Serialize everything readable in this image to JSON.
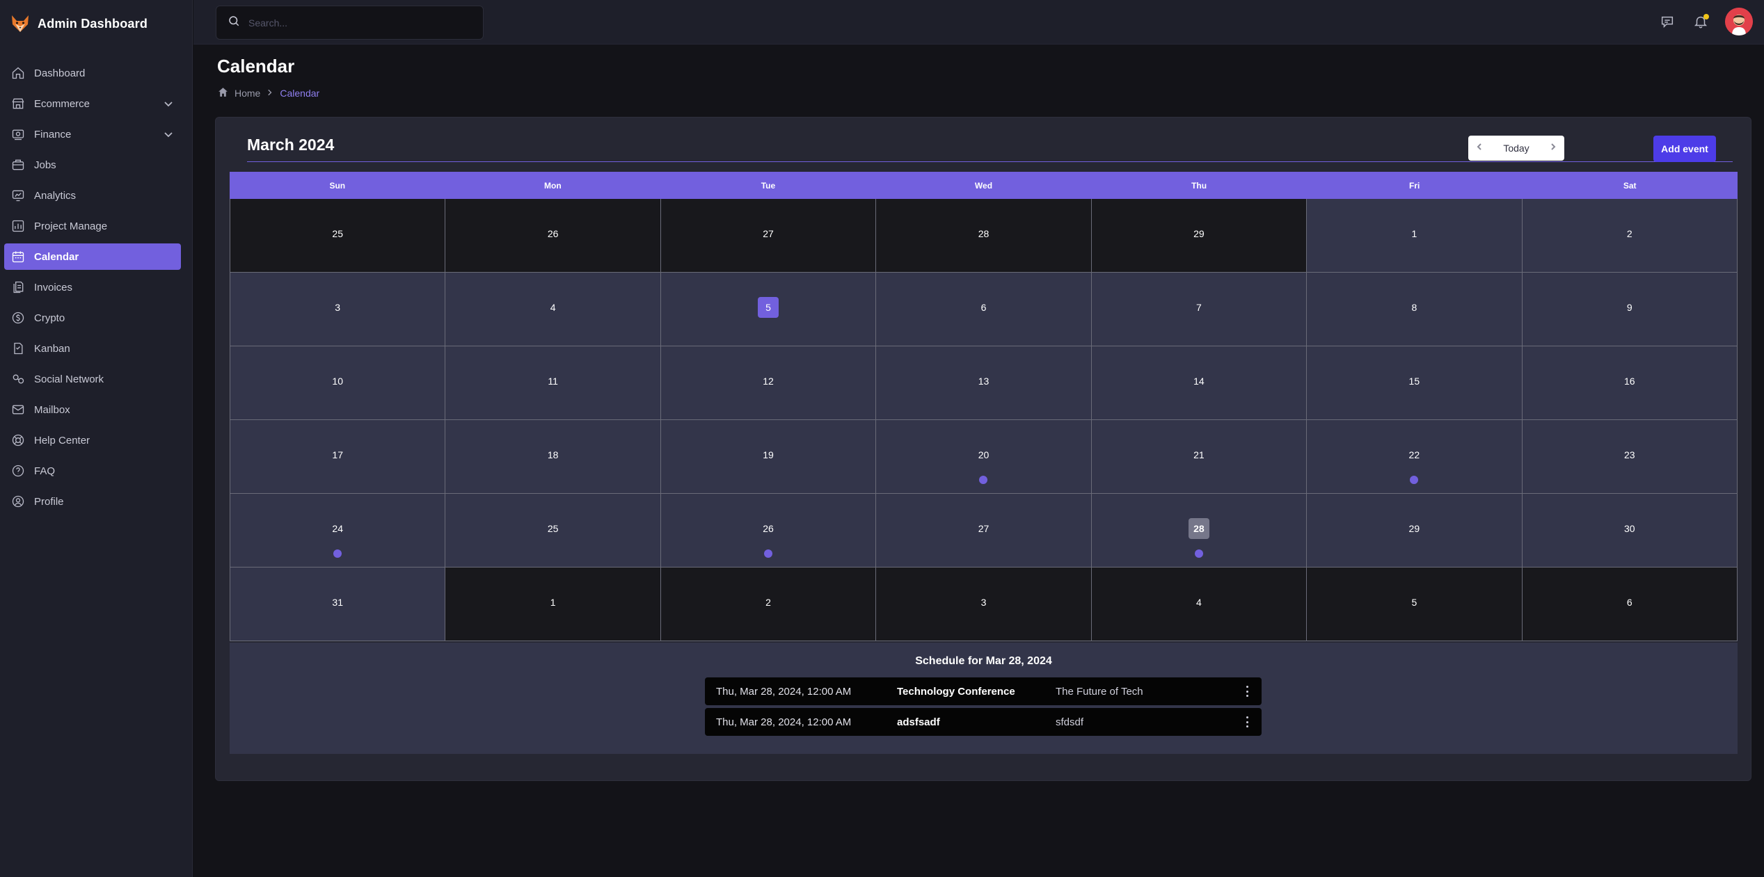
{
  "brand": {
    "title": "Admin Dashboard"
  },
  "sidebar": {
    "items": [
      {
        "label": "Dashboard",
        "icon": "home-icon",
        "active": false,
        "expandable": false
      },
      {
        "label": "Ecommerce",
        "icon": "store-icon",
        "active": false,
        "expandable": true
      },
      {
        "label": "Finance",
        "icon": "finance-icon",
        "active": false,
        "expandable": true
      },
      {
        "label": "Jobs",
        "icon": "briefcase-icon",
        "active": false,
        "expandable": false
      },
      {
        "label": "Analytics",
        "icon": "analytics-icon",
        "active": false,
        "expandable": false
      },
      {
        "label": "Project Manage",
        "icon": "project-icon",
        "active": false,
        "expandable": false
      },
      {
        "label": "Calendar",
        "icon": "calendar-icon",
        "active": true,
        "expandable": false
      },
      {
        "label": "Invoices",
        "icon": "invoice-icon",
        "active": false,
        "expandable": false
      },
      {
        "label": "Crypto",
        "icon": "crypto-icon",
        "active": false,
        "expandable": false
      },
      {
        "label": "Kanban",
        "icon": "kanban-icon",
        "active": false,
        "expandable": false
      },
      {
        "label": "Social Network",
        "icon": "social-icon",
        "active": false,
        "expandable": false
      },
      {
        "label": "Mailbox",
        "icon": "mail-icon",
        "active": false,
        "expandable": false
      },
      {
        "label": "Help Center",
        "icon": "help-center-icon",
        "active": false,
        "expandable": false
      },
      {
        "label": "FAQ",
        "icon": "faq-icon",
        "active": false,
        "expandable": false
      },
      {
        "label": "Profile",
        "icon": "profile-icon",
        "active": false,
        "expandable": false
      }
    ]
  },
  "search": {
    "placeholder": "Search...",
    "value": ""
  },
  "page": {
    "title": "Calendar",
    "breadcrumb": {
      "home": "Home",
      "current": "Calendar"
    }
  },
  "calendar": {
    "month_title": "March 2024",
    "today_label": "Today",
    "add_event_label": "Add event",
    "weekdays": [
      "Sun",
      "Mon",
      "Tue",
      "Wed",
      "Thu",
      "Fri",
      "Sat"
    ],
    "weeks": [
      [
        {
          "d": "25",
          "other": true
        },
        {
          "d": "26",
          "other": true
        },
        {
          "d": "27",
          "other": true
        },
        {
          "d": "28",
          "other": true
        },
        {
          "d": "29",
          "other": true
        },
        {
          "d": "1"
        },
        {
          "d": "2"
        }
      ],
      [
        {
          "d": "3"
        },
        {
          "d": "4"
        },
        {
          "d": "5",
          "selected": true
        },
        {
          "d": "6"
        },
        {
          "d": "7"
        },
        {
          "d": "8"
        },
        {
          "d": "9"
        }
      ],
      [
        {
          "d": "10"
        },
        {
          "d": "11"
        },
        {
          "d": "12"
        },
        {
          "d": "13"
        },
        {
          "d": "14"
        },
        {
          "d": "15"
        },
        {
          "d": "16"
        }
      ],
      [
        {
          "d": "17"
        },
        {
          "d": "18"
        },
        {
          "d": "19"
        },
        {
          "d": "20",
          "event": true
        },
        {
          "d": "21"
        },
        {
          "d": "22",
          "event": true
        },
        {
          "d": "23"
        }
      ],
      [
        {
          "d": "24",
          "event": true
        },
        {
          "d": "25"
        },
        {
          "d": "26",
          "event": true
        },
        {
          "d": "27"
        },
        {
          "d": "28",
          "today": true,
          "event": true
        },
        {
          "d": "29"
        },
        {
          "d": "30"
        }
      ],
      [
        {
          "d": "31"
        },
        {
          "d": "1",
          "other": true
        },
        {
          "d": "2",
          "other": true
        },
        {
          "d": "3",
          "other": true
        },
        {
          "d": "4",
          "other": true
        },
        {
          "d": "5",
          "other": true
        },
        {
          "d": "6",
          "other": true
        }
      ]
    ]
  },
  "schedule": {
    "title": "Schedule for Mar 28, 2024",
    "events": [
      {
        "time": "Thu, Mar 28, 2024, 12:00 AM",
        "title": "Technology Conference",
        "description": "The Future of Tech"
      },
      {
        "time": "Thu, Mar 28, 2024, 12:00 AM",
        "title": "adsfsadf",
        "description": "sfdsdf"
      }
    ]
  },
  "colors": {
    "accent": "#7260de",
    "add_button": "#4d3ce8",
    "notification_dot": "#f0c419",
    "avatar_bg": "#e2404a"
  }
}
